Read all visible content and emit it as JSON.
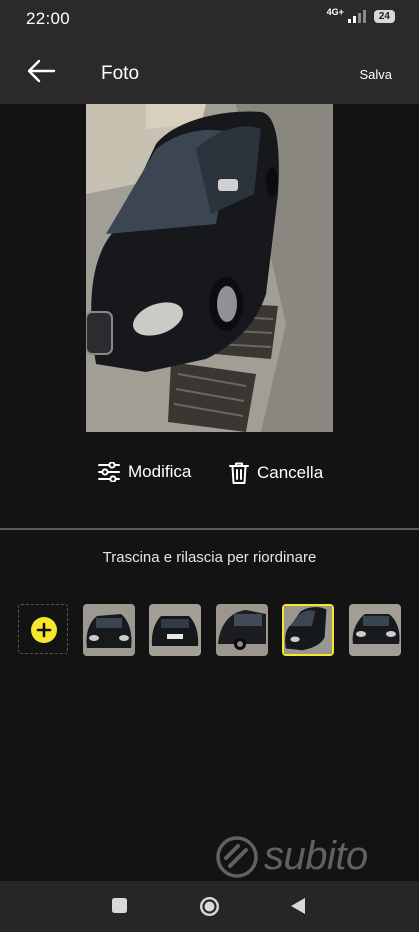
{
  "status_bar": {
    "time": "22:00",
    "network": "4G+",
    "battery": "24"
  },
  "app_bar": {
    "title": "Foto",
    "save_label": "Salva",
    "back_icon": "arrow-left-icon"
  },
  "photo_actions": {
    "edit_label": "Modifica",
    "edit_icon": "sliders-icon",
    "delete_label": "Cancella",
    "delete_icon": "trash-icon"
  },
  "reorder_hint": "Trascina e rilascia per riordinare",
  "thumbnails": {
    "add_icon": "plus-circle-icon",
    "accent_color": "#f7e62c",
    "selected_index": 4,
    "count": 6
  },
  "watermark": {
    "text": "subito"
  },
  "nav_bar": {
    "buttons": [
      "recents-icon",
      "home-icon",
      "back-triangle-icon"
    ]
  }
}
